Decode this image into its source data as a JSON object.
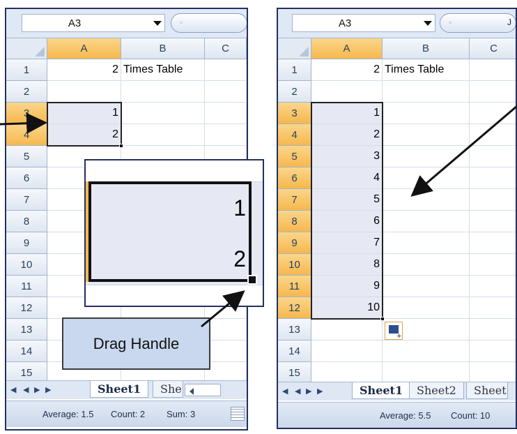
{
  "left_panel": {
    "name_box": "A3",
    "fx_placeholder": "◦",
    "columns": [
      "A",
      "B",
      "C"
    ],
    "rows": [
      {
        "num": "1",
        "a": "2",
        "b": "Times Table"
      },
      {
        "num": "2",
        "a": "",
        "b": ""
      },
      {
        "num": "3",
        "a": "1",
        "b": ""
      },
      {
        "num": "4",
        "a": "2",
        "b": ""
      },
      {
        "num": "5",
        "a": "",
        "b": ""
      },
      {
        "num": "6",
        "a": "",
        "b": ""
      },
      {
        "num": "7",
        "a": "",
        "b": ""
      },
      {
        "num": "8",
        "a": "",
        "b": ""
      },
      {
        "num": "9",
        "a": "",
        "b": ""
      },
      {
        "num": "10",
        "a": "",
        "b": ""
      },
      {
        "num": "11",
        "a": "",
        "b": ""
      },
      {
        "num": "12",
        "a": "",
        "b": ""
      },
      {
        "num": "13",
        "a": "",
        "b": ""
      },
      {
        "num": "14",
        "a": "",
        "b": ""
      },
      {
        "num": "15",
        "a": "",
        "b": ""
      }
    ],
    "tabs": [
      "Sheet1",
      "She"
    ],
    "status": {
      "average": "Average: 1.5",
      "count": "Count: 2",
      "sum": "Sum: 3"
    }
  },
  "right_panel": {
    "name_box": "A3",
    "fx_placeholder": "◦",
    "fx_right": "J",
    "columns": [
      "A",
      "B",
      "C"
    ],
    "rows": [
      {
        "num": "1",
        "a": "2",
        "b": "Times Table"
      },
      {
        "num": "2",
        "a": "",
        "b": ""
      },
      {
        "num": "3",
        "a": "1",
        "b": ""
      },
      {
        "num": "4",
        "a": "2",
        "b": ""
      },
      {
        "num": "5",
        "a": "3",
        "b": ""
      },
      {
        "num": "6",
        "a": "4",
        "b": ""
      },
      {
        "num": "7",
        "a": "5",
        "b": ""
      },
      {
        "num": "8",
        "a": "6",
        "b": ""
      },
      {
        "num": "9",
        "a": "7",
        "b": ""
      },
      {
        "num": "10",
        "a": "8",
        "b": ""
      },
      {
        "num": "11",
        "a": "9",
        "b": ""
      },
      {
        "num": "12",
        "a": "10",
        "b": ""
      },
      {
        "num": "13",
        "a": "",
        "b": ""
      },
      {
        "num": "14",
        "a": "",
        "b": ""
      },
      {
        "num": "15",
        "a": "",
        "b": ""
      }
    ],
    "tabs": [
      "Sheet1",
      "Sheet2",
      "Sheet"
    ],
    "status": {
      "average": "Average: 5.5",
      "count": "Count: 10"
    }
  },
  "zoom_inset": {
    "value1": "1",
    "value2": "2"
  },
  "callout": {
    "label": "Drag Handle"
  },
  "colors": {
    "frame": "#23305f",
    "selected_header": "#f6b84e",
    "selection_fill": "#e6e9f4",
    "callout_fill": "#c9d8ee",
    "ribbon": "#dfe8f5"
  }
}
